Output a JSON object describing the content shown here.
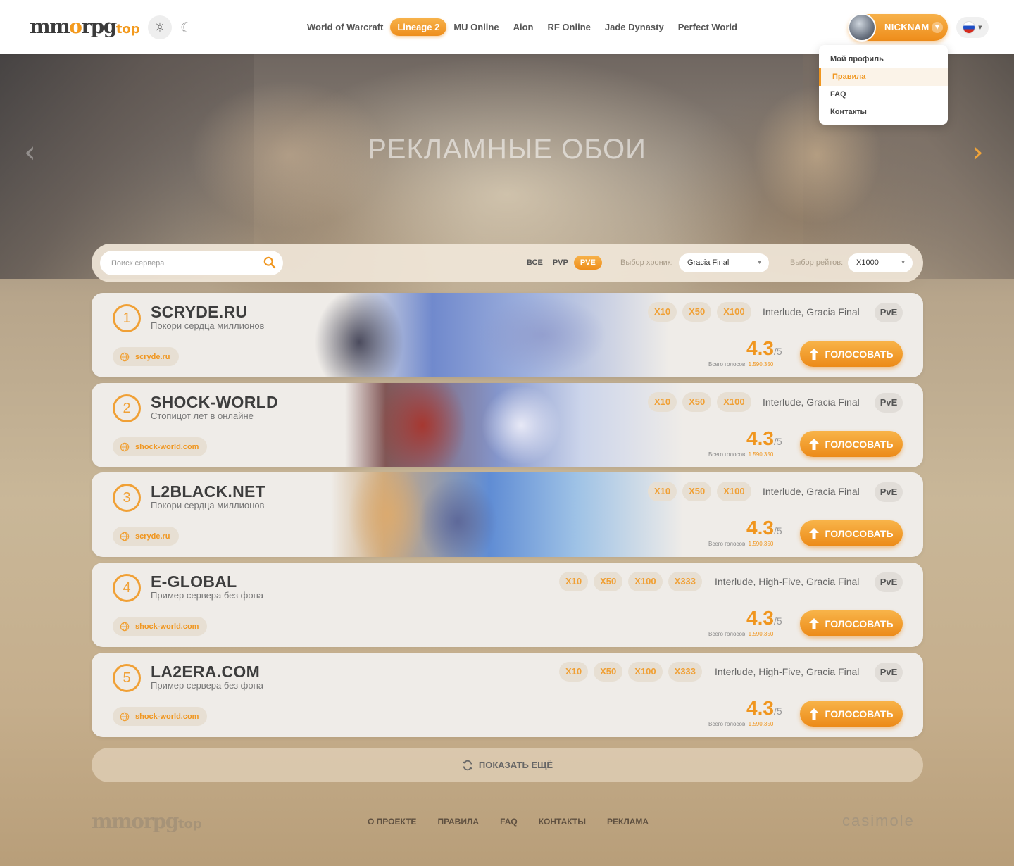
{
  "header": {
    "logo_main": "mm",
    "logo_o": "o",
    "logo_rest": "rpg",
    "logo_top": "top",
    "nav": [
      "World of Warcraft",
      "Lineage 2",
      "MU Online",
      "Aion",
      "RF Online",
      "Jade Dynasty",
      "Perfect World"
    ],
    "nav_active": "Lineage 2",
    "user_name": "NICKNAM",
    "language": "RU"
  },
  "dropdown": {
    "items": [
      "Мой профиль",
      "Правила",
      "FAQ",
      "Контакты"
    ],
    "active": "Правила"
  },
  "hero": {
    "title": "РЕКЛАМНЫЕ ОБОИ"
  },
  "filters": {
    "search_placeholder": "Поиск сервера",
    "types": [
      "ВСЕ",
      "PVP",
      "PVE"
    ],
    "type_active": "PVE",
    "chronicle_label": "Выбор хроник:",
    "chronicle_value": "Gracia Final",
    "rate_label": "Выбор рейтов:",
    "rate_value": "X1000"
  },
  "servers": [
    {
      "rank": "1",
      "name": "SCRYDE.RU",
      "desc": "Покори сердца миллионов",
      "site": "scryde.ru",
      "rates": [
        "X10",
        "X50",
        "X100"
      ],
      "chronicles": "Interlude, Gracia Final",
      "mode": "PvE",
      "rating": "4.3",
      "rating_max": "/5",
      "votes_label": "Всего голосов:",
      "votes": "1.590.350",
      "vote_button": "ГОЛОСОВАТЬ"
    },
    {
      "rank": "2",
      "name": "SHOCK-WORLD",
      "desc": "Стопицот лет в онлайне",
      "site": "shock-world.com",
      "rates": [
        "X10",
        "X50",
        "X100"
      ],
      "chronicles": "Interlude, Gracia Final",
      "mode": "PvE",
      "rating": "4.3",
      "rating_max": "/5",
      "votes_label": "Всего голосов:",
      "votes": "1.590.350",
      "vote_button": "ГОЛОСОВАТЬ"
    },
    {
      "rank": "3",
      "name": "L2BLACK.NET",
      "desc": "Покори сердца миллионов",
      "site": "scryde.ru",
      "rates": [
        "X10",
        "X50",
        "X100"
      ],
      "chronicles": "Interlude, Gracia Final",
      "mode": "PvE",
      "rating": "4.3",
      "rating_max": "/5",
      "votes_label": "Всего голосов:",
      "votes": "1.590.350",
      "vote_button": "ГОЛОСОВАТЬ"
    },
    {
      "rank": "4",
      "name": "E-GLOBAL",
      "desc": "Пример сервера без фона",
      "site": "shock-world.com",
      "rates": [
        "X10",
        "X50",
        "X100",
        "X333"
      ],
      "chronicles": "Interlude, High-Five, Gracia Final",
      "mode": "PvE",
      "rating": "4.3",
      "rating_max": "/5",
      "votes_label": "Всего голосов:",
      "votes": "1.590.350",
      "vote_button": "ГОЛОСОВАТЬ"
    },
    {
      "rank": "5",
      "name": "LA2ERA.COM",
      "desc": "Пример сервера без фона",
      "site": "shock-world.com",
      "rates": [
        "X10",
        "X50",
        "X100",
        "X333"
      ],
      "chronicles": "Interlude, High-Five, Gracia Final",
      "mode": "PvE",
      "rating": "4.3",
      "rating_max": "/5",
      "votes_label": "Всего голосов:",
      "votes": "1.590.350",
      "vote_button": "ГОЛОСОВАТЬ"
    }
  ],
  "show_more": "ПОКАЗАТЬ ЕЩЁ",
  "footer": {
    "links": [
      "О ПРОЕКТЕ",
      "ПРАВИЛА",
      "FAQ",
      "КОНТАКТЫ",
      "РЕКЛАМА"
    ],
    "studio": "casimole"
  },
  "colors": {
    "accent": "#f0961f",
    "card_bg": "#efece8",
    "chip_bg": "#e7dfd3"
  }
}
